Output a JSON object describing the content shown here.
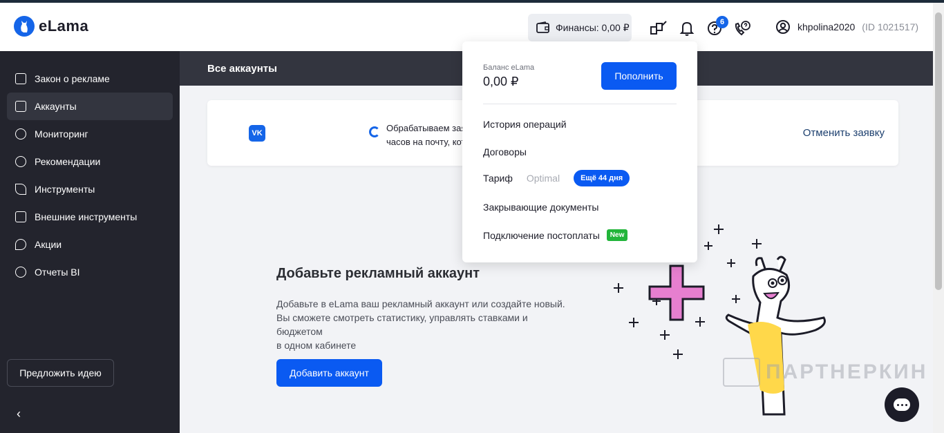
{
  "header": {
    "logo_text": "eLama",
    "finance_label": "Финансы: 0,00 ₽",
    "help_badge": "6",
    "username": "khpolina2020",
    "user_id": "(ID 1021517)"
  },
  "sidebar": {
    "items": [
      {
        "label": "Закон о рекламе",
        "icon": "id-card-icon"
      },
      {
        "label": "Аккаунты",
        "icon": "accounts-icon"
      },
      {
        "label": "Мониторинг",
        "icon": "clock-icon"
      },
      {
        "label": "Рекомендации",
        "icon": "check-circle-icon"
      },
      {
        "label": "Инструменты",
        "icon": "magic-wand-icon"
      },
      {
        "label": "Внешние инструменты",
        "icon": "external-link-icon"
      },
      {
        "label": "Акции",
        "icon": "flame-icon"
      },
      {
        "label": "Отчеты BI",
        "icon": "chart-pie-icon"
      }
    ],
    "active_index": 1,
    "idea_button": "Предложить идею",
    "collapse_icon": "‹"
  },
  "subheader": {
    "title": "Все аккаунты"
  },
  "card": {
    "vk_label": "VK",
    "line1": "Обрабатываем заяв",
    "line2": "часов на почту, кото",
    "cancel_link": "Отменить заявку"
  },
  "empty_state": {
    "title": "Добавьте рекламный аккаунт",
    "desc_line1": "Добавьте в eLama ваш рекламный аккаунт или создайте новый.",
    "desc_line2": "Вы сможете смотреть статистику, управлять ставками и бюджетом",
    "desc_line3": "в одном кабинете",
    "add_button": "Добавить аккаунт"
  },
  "dropdown": {
    "balance_label": "Баланс eLama",
    "balance_value": "0,00 ₽",
    "topup_button": "Пополнить",
    "history": "История операций",
    "contracts": "Договоры",
    "tariff_label": "Тариф",
    "tariff_value": "Optimal",
    "tariff_days": "Ещё 44 дня",
    "closing_docs": "Закрывающие документы",
    "postpay": "Подключение постоплаты",
    "new_badge": "New"
  },
  "watermark": "ПАРТНЕРКИН",
  "colors": {
    "accent": "#0a5af2",
    "sidebar_bg": "#23242d",
    "new_badge": "#22b53a",
    "llama_pink": "#e67fcf",
    "llama_yellow": "#ffd84a"
  }
}
